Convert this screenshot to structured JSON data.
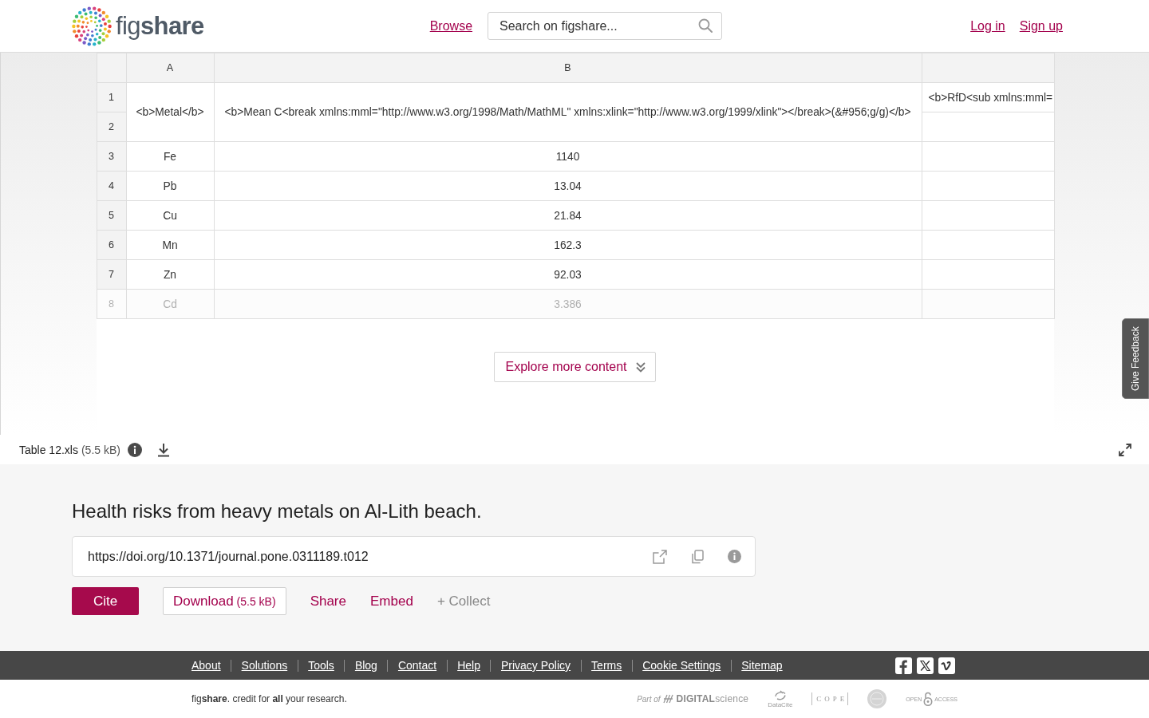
{
  "header": {
    "logo_text": "fig**share**",
    "nav_link": "Browse",
    "search": {
      "placeholder": "Search on figshare..."
    },
    "account_links": [
      "Log in",
      "Sign up"
    ]
  },
  "viewer": {
    "spreadsheet": {
      "columns": [
        {
          "label": "A"
        },
        {
          "label": "B"
        },
        {}
      ],
      "heading_rows": {
        "numbers": [
          "1",
          "2"
        ],
        "cells": [
          {
            "text": "<b>Metal</b>",
            "merged": true
          },
          {
            "text": "<b>Mean C<break xmlns:mml=\"http://www.w3.org/1998/Math/MathML\" xmlns:xlink=\"http://www.w3.org/1999/xlink\"></break>(&#956;g/g)</b>",
            "merged": true
          },
          {
            "text": "<b>RfD<sub xmlns:mml=",
            "merged": false
          }
        ]
      },
      "rows": [
        {
          "number": "3",
          "cells": [
            "Fe",
            "1140"
          ],
          "faded": false
        },
        {
          "number": "4",
          "cells": [
            "Pb",
            "13.04"
          ],
          "faded": false
        },
        {
          "number": "5",
          "cells": [
            "Cu",
            "21.84"
          ],
          "faded": false
        },
        {
          "number": "6",
          "cells": [
            "Mn",
            "162.3"
          ],
          "faded": false
        },
        {
          "number": "7",
          "cells": [
            "Zn",
            "92.03"
          ],
          "faded": false
        },
        {
          "number": "8",
          "cells": [
            "Cd",
            "3.386"
          ],
          "faded": true
        }
      ]
    },
    "explore_button": "Explore more content",
    "feedback_tab": "Give Feedback"
  },
  "file_bar": {
    "file_name": "Table 12.xls",
    "file_size": "(5.5 kB)"
  },
  "item": {
    "title": "Health risks from heavy metals on Al-Lith beach.",
    "doi": "https://doi.org/10.1371/journal.pone.0311189.t012",
    "actions": [
      {
        "kind": "primary",
        "label": "Cite"
      },
      {
        "kind": "outline",
        "label": "Download",
        "detail": "(5.5 kB)"
      },
      {
        "kind": "link",
        "label": "Share"
      },
      {
        "kind": "link",
        "label": "Embed"
      },
      {
        "kind": "muted",
        "label": "+ Collect"
      }
    ]
  },
  "footer": {
    "links": [
      "About",
      "Solutions",
      "Tools",
      "Blog",
      "Contact",
      "Help",
      "Privacy Policy",
      "Terms",
      "Cookie Settings",
      "Sitemap"
    ],
    "social": [
      {
        "kind": "facebook"
      },
      {
        "kind": "x"
      },
      {
        "kind": "vimeo"
      }
    ],
    "tagline": "fig**share**. credit for **all** your research.",
    "partners": [
      {
        "kind": "digital-science",
        "prefix": "Part of",
        "name": "**DIGITAL**science"
      },
      {
        "kind": "datacite",
        "name": "DataCite"
      },
      {
        "kind": "cope",
        "name": "COPE"
      },
      {
        "kind": "seal"
      },
      {
        "kind": "open-access",
        "before": "OPEN",
        "after": "ACCESS"
      }
    ]
  }
}
